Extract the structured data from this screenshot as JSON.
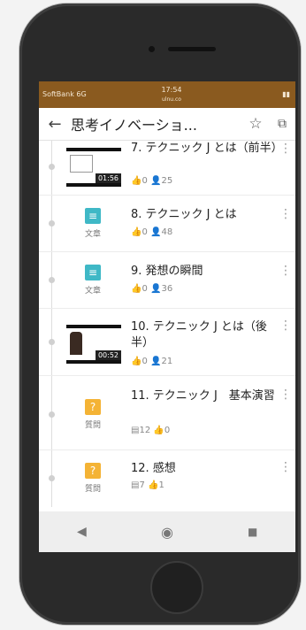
{
  "status": {
    "carrier": "SoftBank 6G",
    "time": "17:54",
    "url": "ulnu.co",
    "battery": "▮▮"
  },
  "header": {
    "title": "思考イノベーショ...",
    "back_icon": "arrow-left-icon",
    "star_icon": "star-icon",
    "external_icon": "external-link-icon"
  },
  "items": [
    {
      "title": "7. テクニック J とは（前半）",
      "likes": "0",
      "users": "25",
      "type": "video",
      "duration": "01:56"
    },
    {
      "title": "8. テクニック J とは",
      "likes": "0",
      "users": "48",
      "type": "doc",
      "type_label": "文章"
    },
    {
      "title": "9. 発想の瞬間",
      "likes": "0",
      "users": "36",
      "type": "doc",
      "type_label": "文章"
    },
    {
      "title": "10. テクニック J とは（後半）",
      "likes": "0",
      "users": "21",
      "type": "video",
      "duration": "00:52"
    },
    {
      "title": "11. テクニック J　基本演習",
      "count": "12",
      "likes": "0",
      "type": "question",
      "type_label": "質問"
    },
    {
      "title": "12. 感想",
      "count": "7",
      "likes": "1",
      "type": "question",
      "type_label": "質問"
    }
  ],
  "nav": {
    "back": "◀",
    "home": "◉",
    "recent": "■"
  }
}
